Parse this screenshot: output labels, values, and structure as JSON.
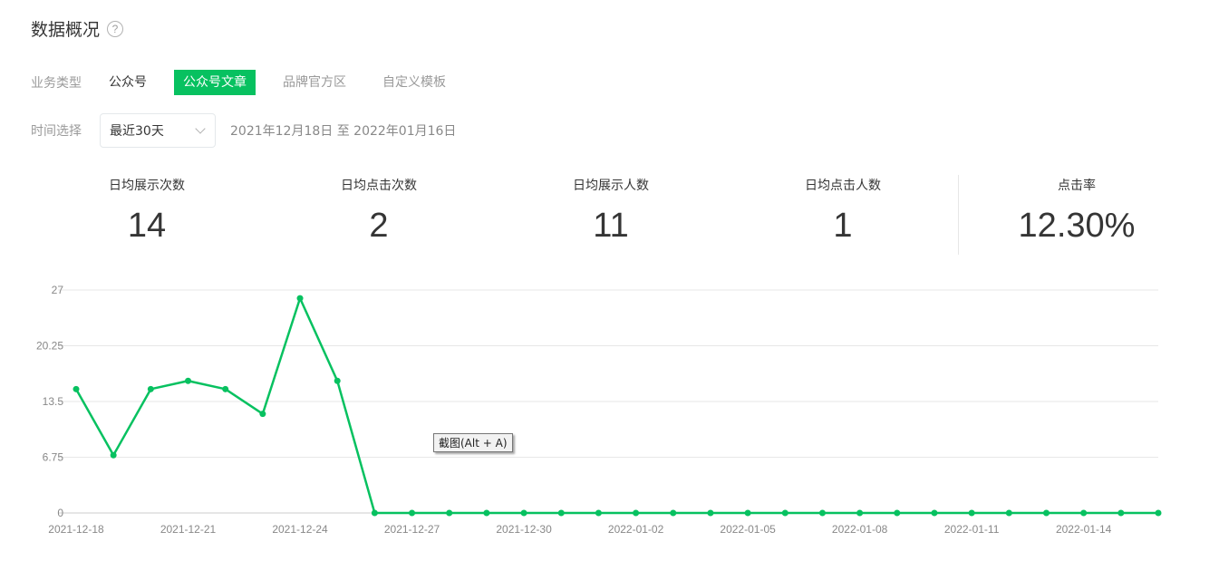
{
  "header": {
    "title": "数据概况",
    "help_icon": "?"
  },
  "filters": {
    "business_label": "业务类型",
    "business_types": [
      {
        "label": "公众号",
        "state": "default"
      },
      {
        "label": "公众号文章",
        "state": "active"
      },
      {
        "label": "品牌官方区",
        "state": "muted"
      },
      {
        "label": "自定义模板",
        "state": "muted"
      }
    ],
    "time_label": "时间选择",
    "time_select_value": "最近30天",
    "date_range": "2021年12月18日 至 2022年01月16日"
  },
  "metrics": [
    {
      "label": "日均展示次数",
      "value": "14"
    },
    {
      "label": "日均点击次数",
      "value": "2"
    },
    {
      "label": "日均展示人数",
      "value": "11"
    },
    {
      "label": "日均点击人数",
      "value": "1"
    },
    {
      "label": "点击率",
      "value": "12.30%"
    }
  ],
  "colors": {
    "accent": "#07c160",
    "grid": "#e7e7e7",
    "axis_text": "#888888"
  },
  "tooltip": "截图(Alt + A)",
  "chart_data": {
    "type": "line",
    "x": [
      "2021-12-18",
      "2021-12-19",
      "2021-12-20",
      "2021-12-21",
      "2021-12-22",
      "2021-12-23",
      "2021-12-24",
      "2021-12-25",
      "2021-12-26",
      "2021-12-27",
      "2021-12-28",
      "2021-12-29",
      "2021-12-30",
      "2021-12-31",
      "2022-01-01",
      "2022-01-02",
      "2022-01-03",
      "2022-01-04",
      "2022-01-05",
      "2022-01-06",
      "2022-01-07",
      "2022-01-08",
      "2022-01-09",
      "2022-01-10",
      "2022-01-11",
      "2022-01-12",
      "2022-01-13",
      "2022-01-14",
      "2022-01-15",
      "2022-01-16"
    ],
    "x_tick_labels": [
      "2021-12-18",
      "2021-12-21",
      "2021-12-24",
      "2021-12-27",
      "2021-12-30",
      "2022-01-02",
      "2022-01-05",
      "2022-01-08",
      "2022-01-11",
      "2022-01-14"
    ],
    "series": [
      {
        "values": [
          15,
          7,
          15,
          16,
          15,
          12,
          26,
          16,
          0,
          0,
          0,
          0,
          0,
          0,
          0,
          0,
          0,
          0,
          0,
          0,
          0,
          0,
          0,
          0,
          0,
          0,
          0,
          0,
          0,
          0
        ]
      }
    ],
    "y_ticks": [
      "0",
      "6.75",
      "13.5",
      "20.25",
      "27"
    ],
    "ylim": [
      0,
      27
    ],
    "grid": true,
    "title": "",
    "xlabel": "",
    "ylabel": ""
  }
}
